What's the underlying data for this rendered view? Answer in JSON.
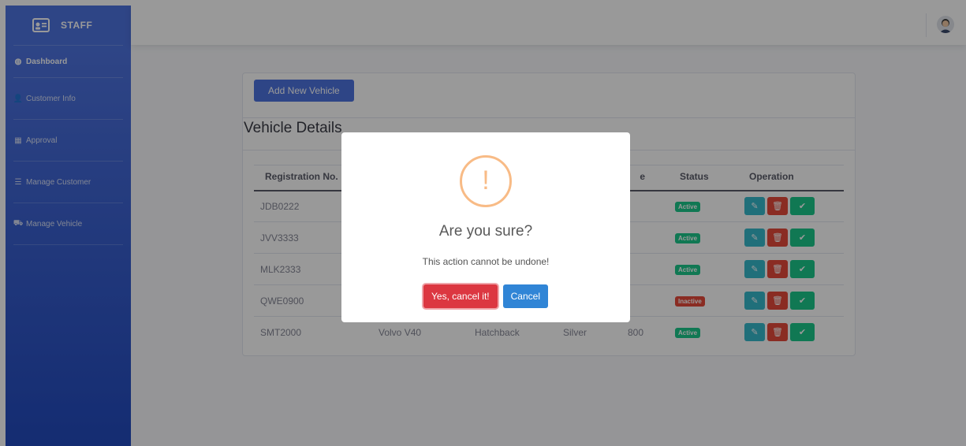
{
  "sidebar": {
    "brand": "STAFF",
    "items": [
      {
        "label": "Dashboard",
        "icon": "dashboard-icon"
      },
      {
        "label": "Customer Info",
        "icon": "user-icon"
      },
      {
        "label": "Approval",
        "icon": "calendar-icon"
      },
      {
        "label": "Manage Customer",
        "icon": "list-icon"
      },
      {
        "label": "Manage Vehicle",
        "icon": "car-icon"
      }
    ]
  },
  "main": {
    "add_button": "Add New Vehicle",
    "title": "Vehicle Details",
    "table": {
      "headers": [
        "Registration No.",
        "",
        "",
        "",
        "e",
        "Status",
        "Operation"
      ],
      "rows": [
        {
          "reg": "JDB0222",
          "model": "",
          "type": "",
          "color": "",
          "rate": "",
          "status": "Active"
        },
        {
          "reg": "JVV3333",
          "model": "",
          "type": "",
          "color": "",
          "rate": "",
          "status": "Active"
        },
        {
          "reg": "MLK2333",
          "model": "",
          "type": "",
          "color": "",
          "rate": "",
          "status": "Active"
        },
        {
          "reg": "QWE0900",
          "model": "",
          "type": "",
          "color": "",
          "rate": "",
          "status": "Inactive"
        },
        {
          "reg": "SMT2000",
          "model": "Volvo V40",
          "type": "Hatchback",
          "color": "Silver",
          "rate": "800",
          "status": "Active"
        }
      ]
    }
  },
  "modal": {
    "icon": "!",
    "title": "Are you sure?",
    "text": "This action cannot be undone!",
    "confirm": "Yes, cancel it!",
    "cancel": "Cancel"
  },
  "colors": {
    "primary": "#4e73df",
    "success": "#1cc88a",
    "danger": "#e74a3b",
    "info": "#36b9cc",
    "warning_ring": "#f8bb86"
  }
}
